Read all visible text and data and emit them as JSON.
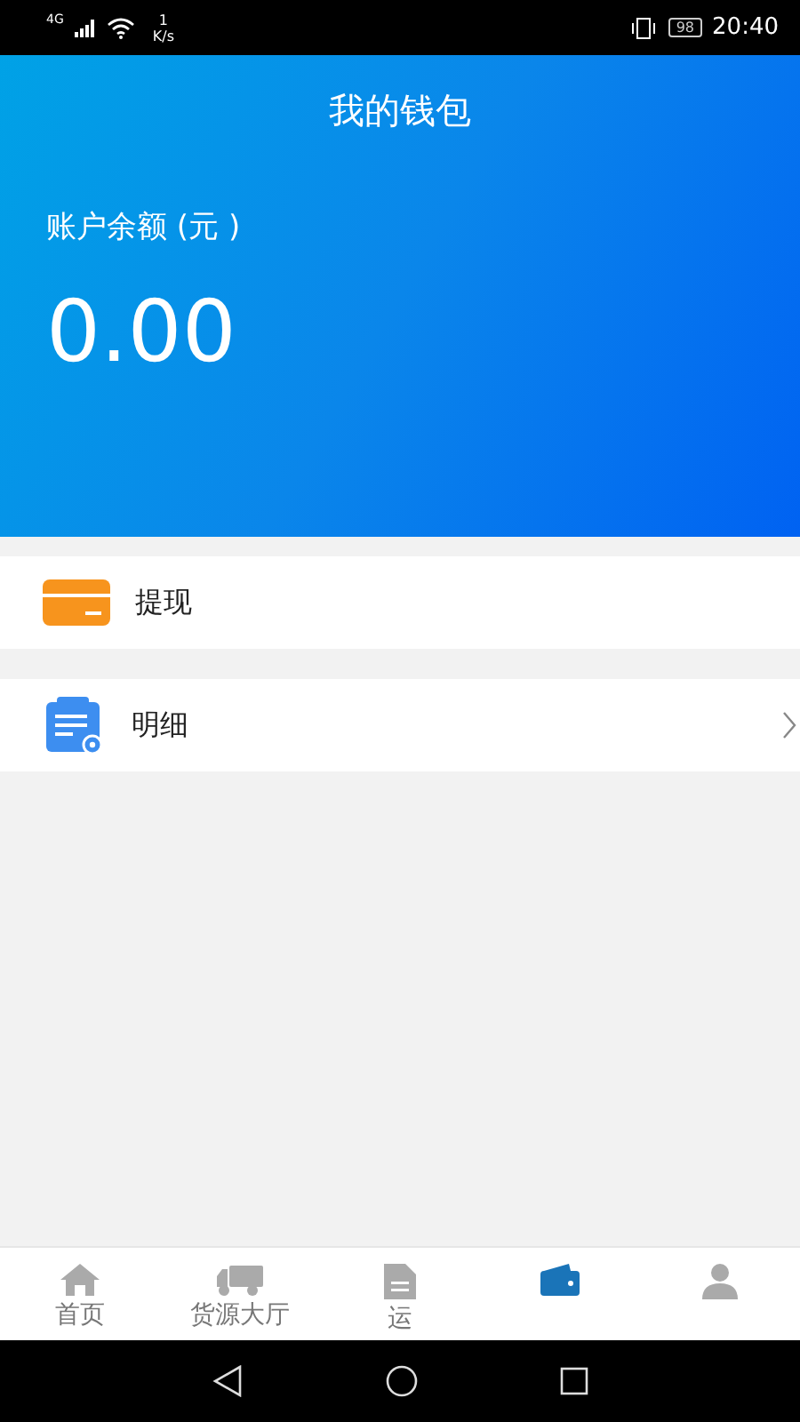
{
  "status_bar": {
    "network": "4G",
    "speed_value": "1",
    "speed_unit": "K/s",
    "battery": "98",
    "time": "20:40"
  },
  "header": {
    "title": "我的钱包",
    "balance_label": "账户余额 (元 )",
    "balance": "0.00"
  },
  "menu": [
    {
      "kind": "card",
      "label": "提现",
      "chevron": false
    },
    {
      "kind": "notes",
      "label": "明细",
      "chevron": true
    }
  ],
  "tabs": [
    {
      "kind": "home",
      "label": "首页",
      "selected": false
    },
    {
      "kind": "truck",
      "label": "货源大厅",
      "selected": false
    },
    {
      "kind": "document",
      "label": "运",
      "selected": false
    },
    {
      "kind": "wallet",
      "selected": true
    },
    {
      "kind": "person",
      "selected": false
    }
  ]
}
